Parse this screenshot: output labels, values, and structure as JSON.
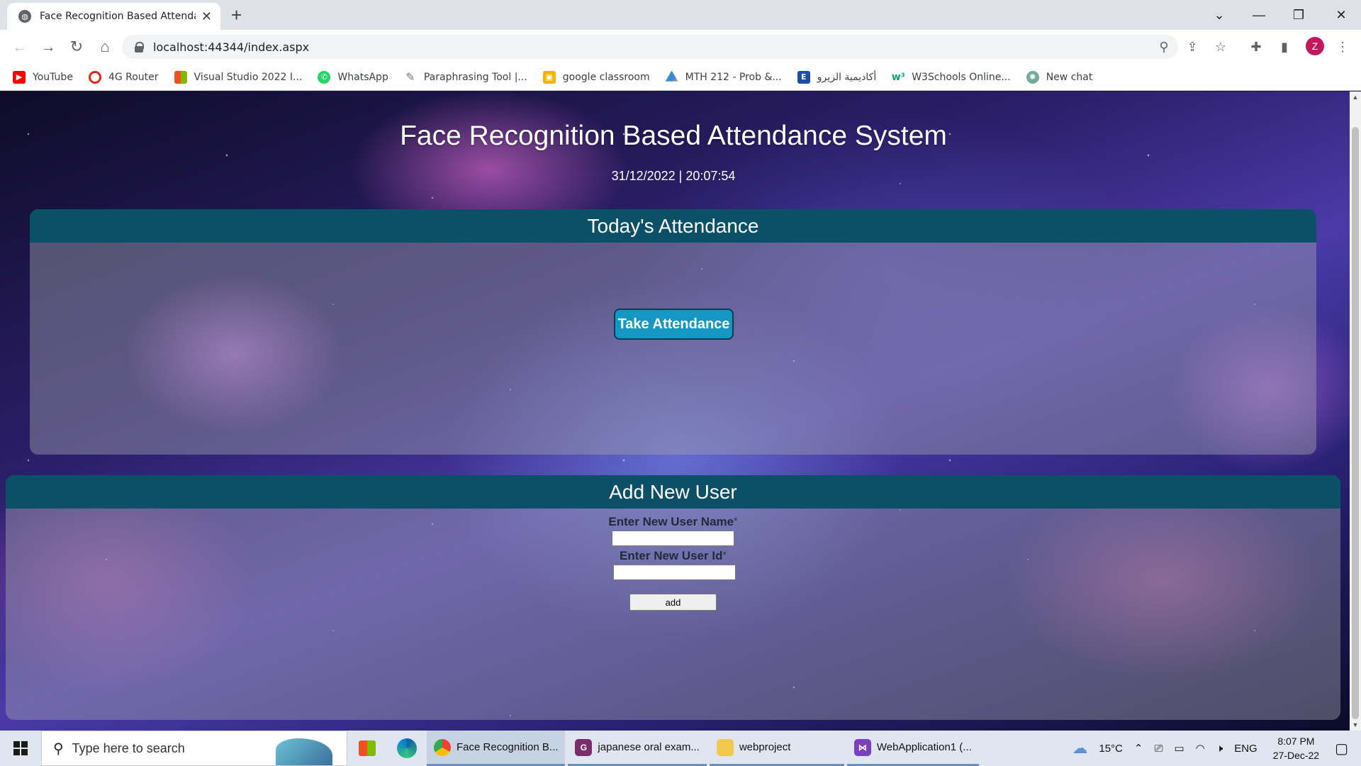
{
  "browser": {
    "tab_title": "Face Recognition Based Attendan",
    "url": "localhost:44344/index.aspx",
    "profile_initial": "Z"
  },
  "bookmarks": [
    {
      "label": "YouTube",
      "icon": "youtube-icon",
      "color": "#ff0000"
    },
    {
      "label": "4G Router",
      "icon": "opera-icon",
      "color": "#e0241b"
    },
    {
      "label": "Visual Studio 2022 I...",
      "icon": "microsoft-icon",
      "color": "#f25022"
    },
    {
      "label": "WhatsApp",
      "icon": "whatsapp-icon",
      "color": "#25d366"
    },
    {
      "label": "Paraphrasing Tool |...",
      "icon": "quill-icon",
      "color": "#777777"
    },
    {
      "label": "google classroom",
      "icon": "classroom-icon",
      "color": "#f4b400"
    },
    {
      "label": "MTH 212 - Prob &...",
      "icon": "drive-icon",
      "color": "#1fa463"
    },
    {
      "label": "أكاديمية الزيرو",
      "icon": "e-icon",
      "color": "#1f4ea8"
    },
    {
      "label": "W3Schools Online...",
      "icon": "w3schools-icon",
      "color": "#04aa6d"
    },
    {
      "label": "New chat",
      "icon": "chatgpt-icon",
      "color": "#74aa9c"
    }
  ],
  "page": {
    "title": "Face Recognition Based Attendance System",
    "datetime": "31/12/2022 | 20:07:54",
    "attendance": {
      "header": "Today's Attendance",
      "button": "Take Attendance"
    },
    "add_user": {
      "header": "Add New User",
      "name_label": "Enter New User Name",
      "id_label": "Enter New User Id",
      "required_mark": "*",
      "name_value": "",
      "id_value": "",
      "button": "add"
    }
  },
  "taskbar": {
    "search_placeholder": "Type here to search",
    "apps": [
      {
        "label": "Face Recognition B...",
        "icon": "chrome-icon",
        "active": true
      },
      {
        "label": "japanese oral exam...",
        "icon": "pdf-icon",
        "active": false
      },
      {
        "label": "webproject",
        "icon": "folder-icon",
        "active": false
      },
      {
        "label": "WebApplication1 (...",
        "icon": "visual-studio-icon",
        "active": false
      }
    ],
    "weather": "15°C",
    "language": "ENG",
    "time": "8:07 PM",
    "date": "27-Dec-22"
  }
}
